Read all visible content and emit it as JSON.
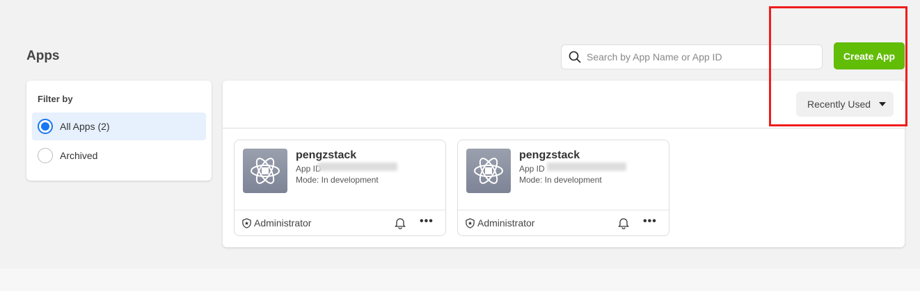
{
  "page": {
    "title": "Apps"
  },
  "search": {
    "placeholder": "Search by App Name or App ID",
    "icon": "search-icon"
  },
  "create_button": {
    "label": "Create App",
    "color": "#62bd07"
  },
  "filter": {
    "heading": "Filter by",
    "options": [
      {
        "label": "All Apps (2)",
        "selected": true
      },
      {
        "label": "Archived",
        "selected": false
      }
    ]
  },
  "sort": {
    "label": "Recently Used"
  },
  "apps": [
    {
      "name": "pengzstack",
      "app_id_label": "App ID",
      "mode": "Mode: In development",
      "role": "Administrator"
    },
    {
      "name": "pengzstack",
      "app_id_label": "App ID",
      "mode": "Mode: In development",
      "role": "Administrator"
    }
  ],
  "highlight_color": "#f01c1c"
}
